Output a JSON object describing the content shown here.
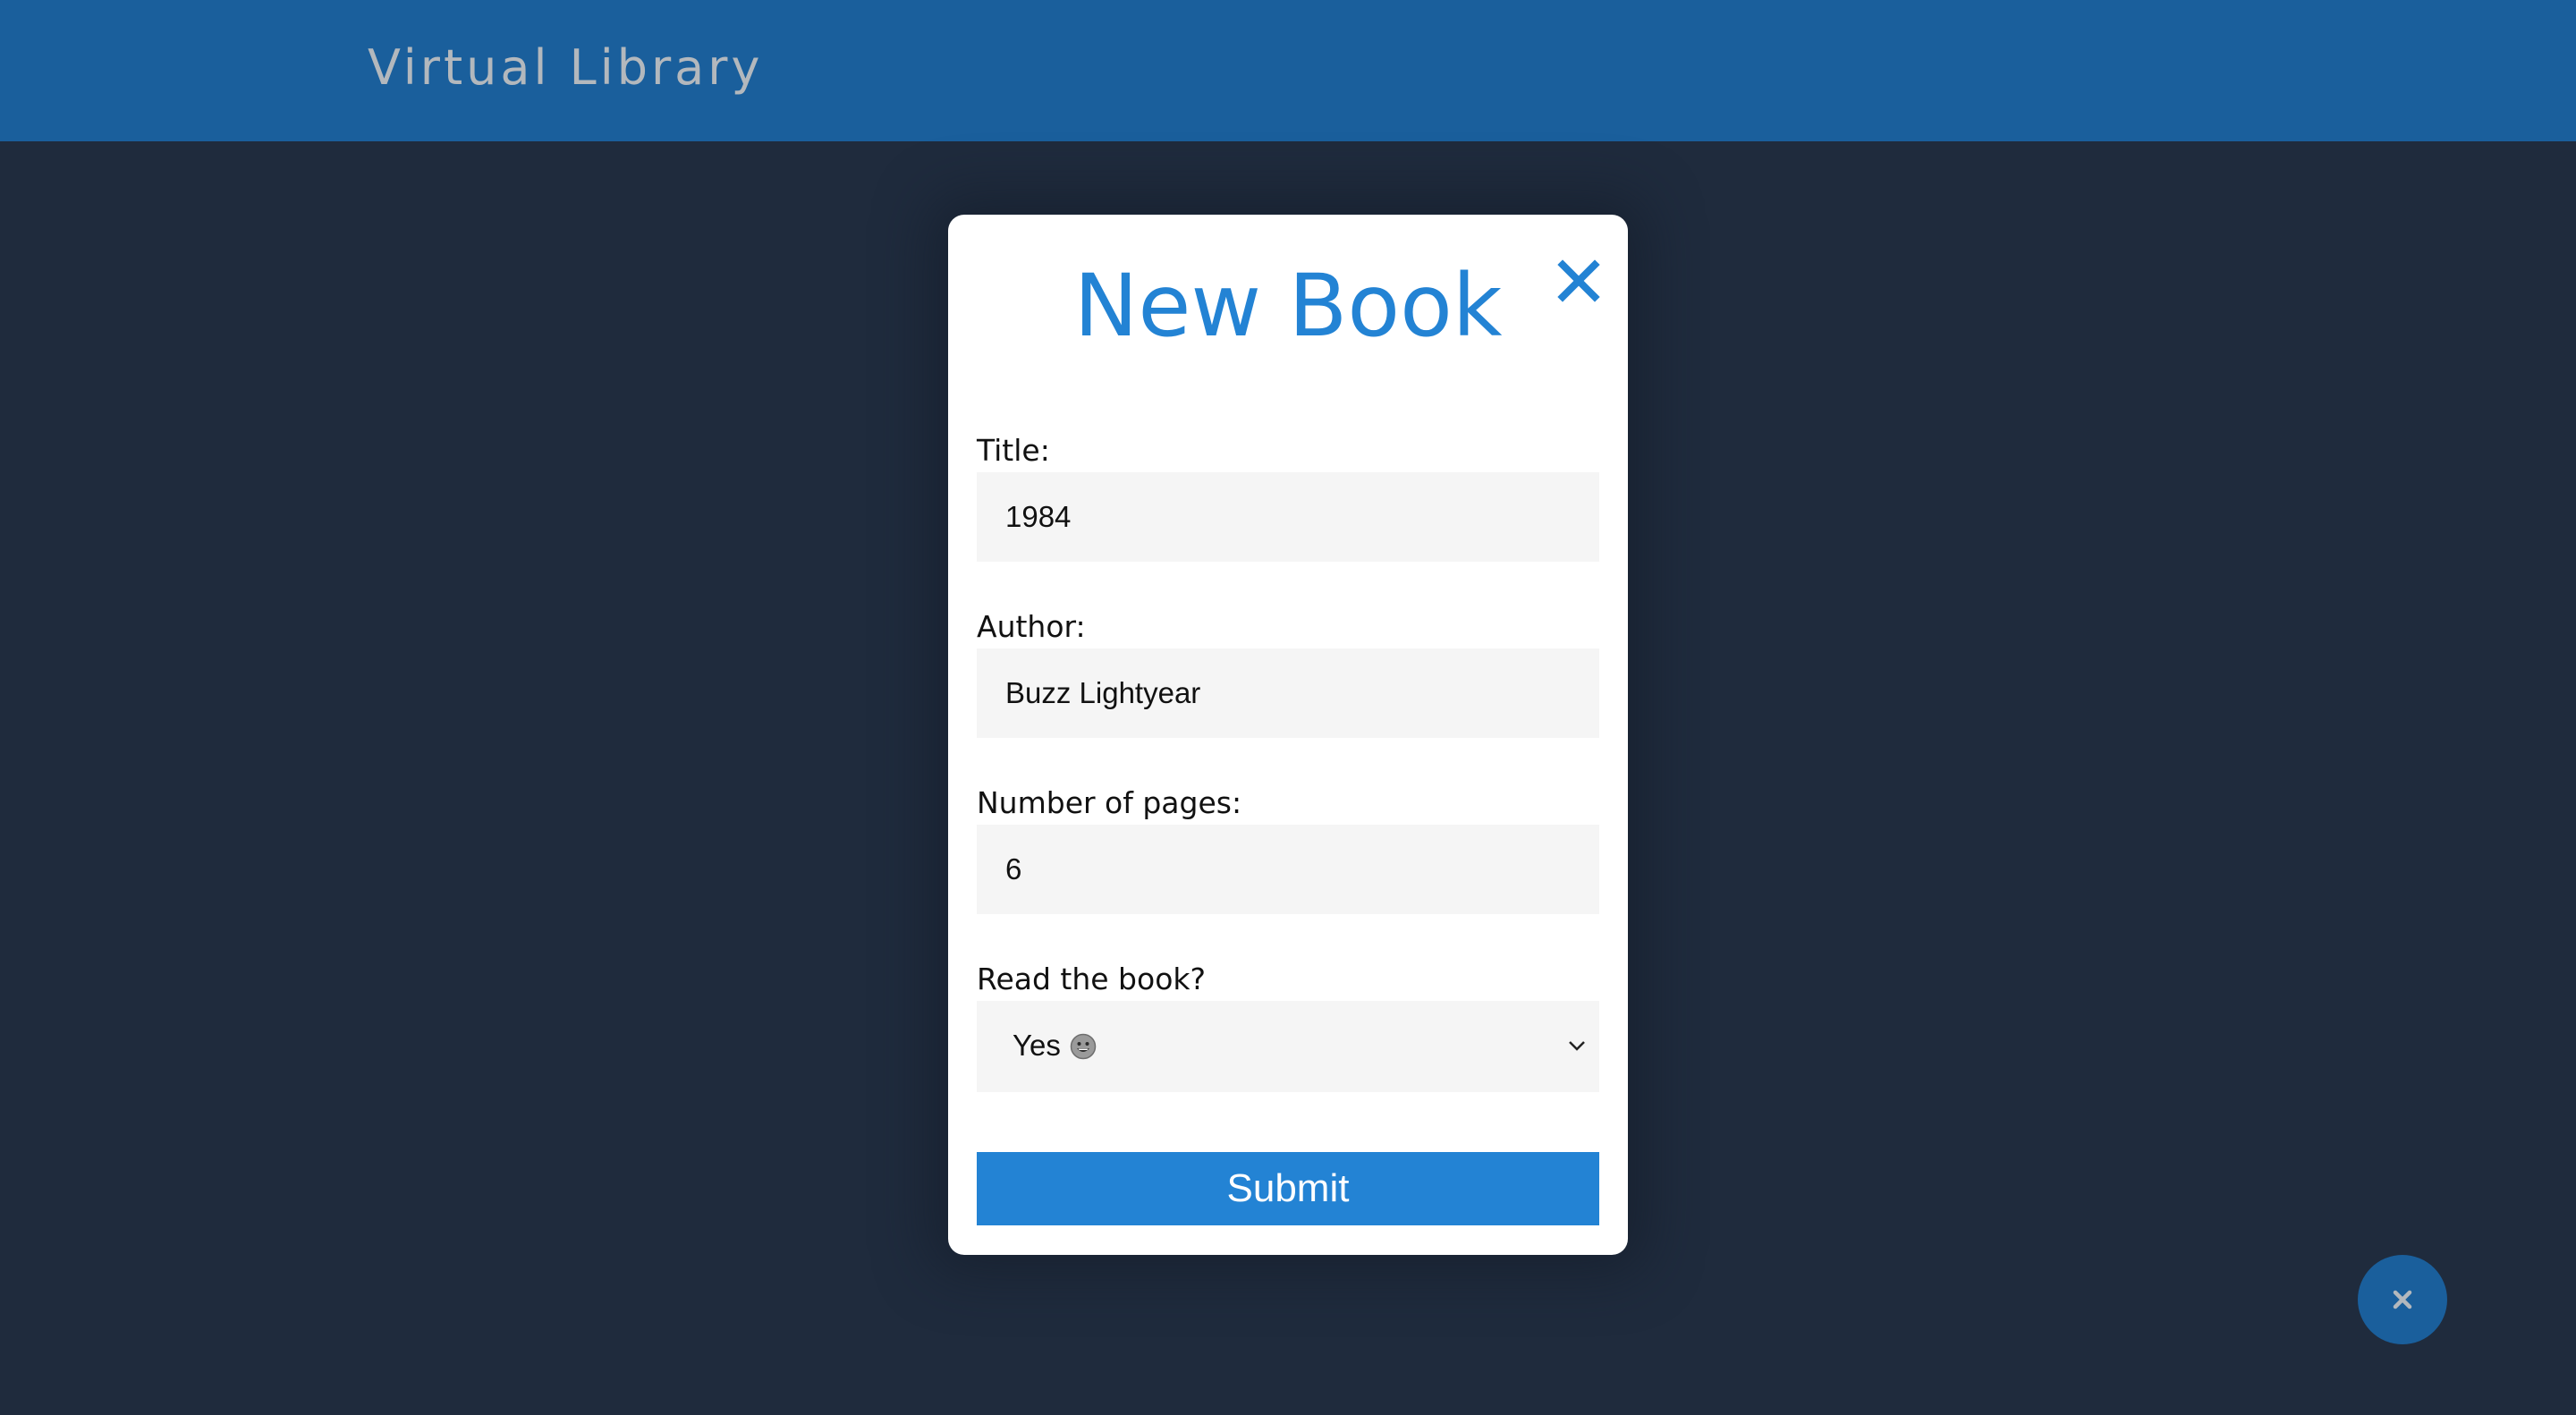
{
  "header": {
    "app_title": "Virtual Library"
  },
  "modal": {
    "title": "New Book",
    "close_icon": "close-icon",
    "fields": {
      "title": {
        "label": "Title:",
        "value": "1984"
      },
      "author": {
        "label": "Author:",
        "value": "Buzz Lightyear"
      },
      "pages": {
        "label": "Number of pages:",
        "value": "6"
      },
      "read": {
        "label": "Read the book?",
        "selected": "Yes",
        "selected_icon": "smiley-emoji-icon"
      }
    },
    "submit_label": "Submit"
  },
  "fab": {
    "icon": "close-icon"
  },
  "colors": {
    "background": "#1f2b3d",
    "header": "#1a5f9c",
    "accent": "#2383d4",
    "input_bg": "#f5f5f5",
    "header_text": "#b3b8bd"
  }
}
